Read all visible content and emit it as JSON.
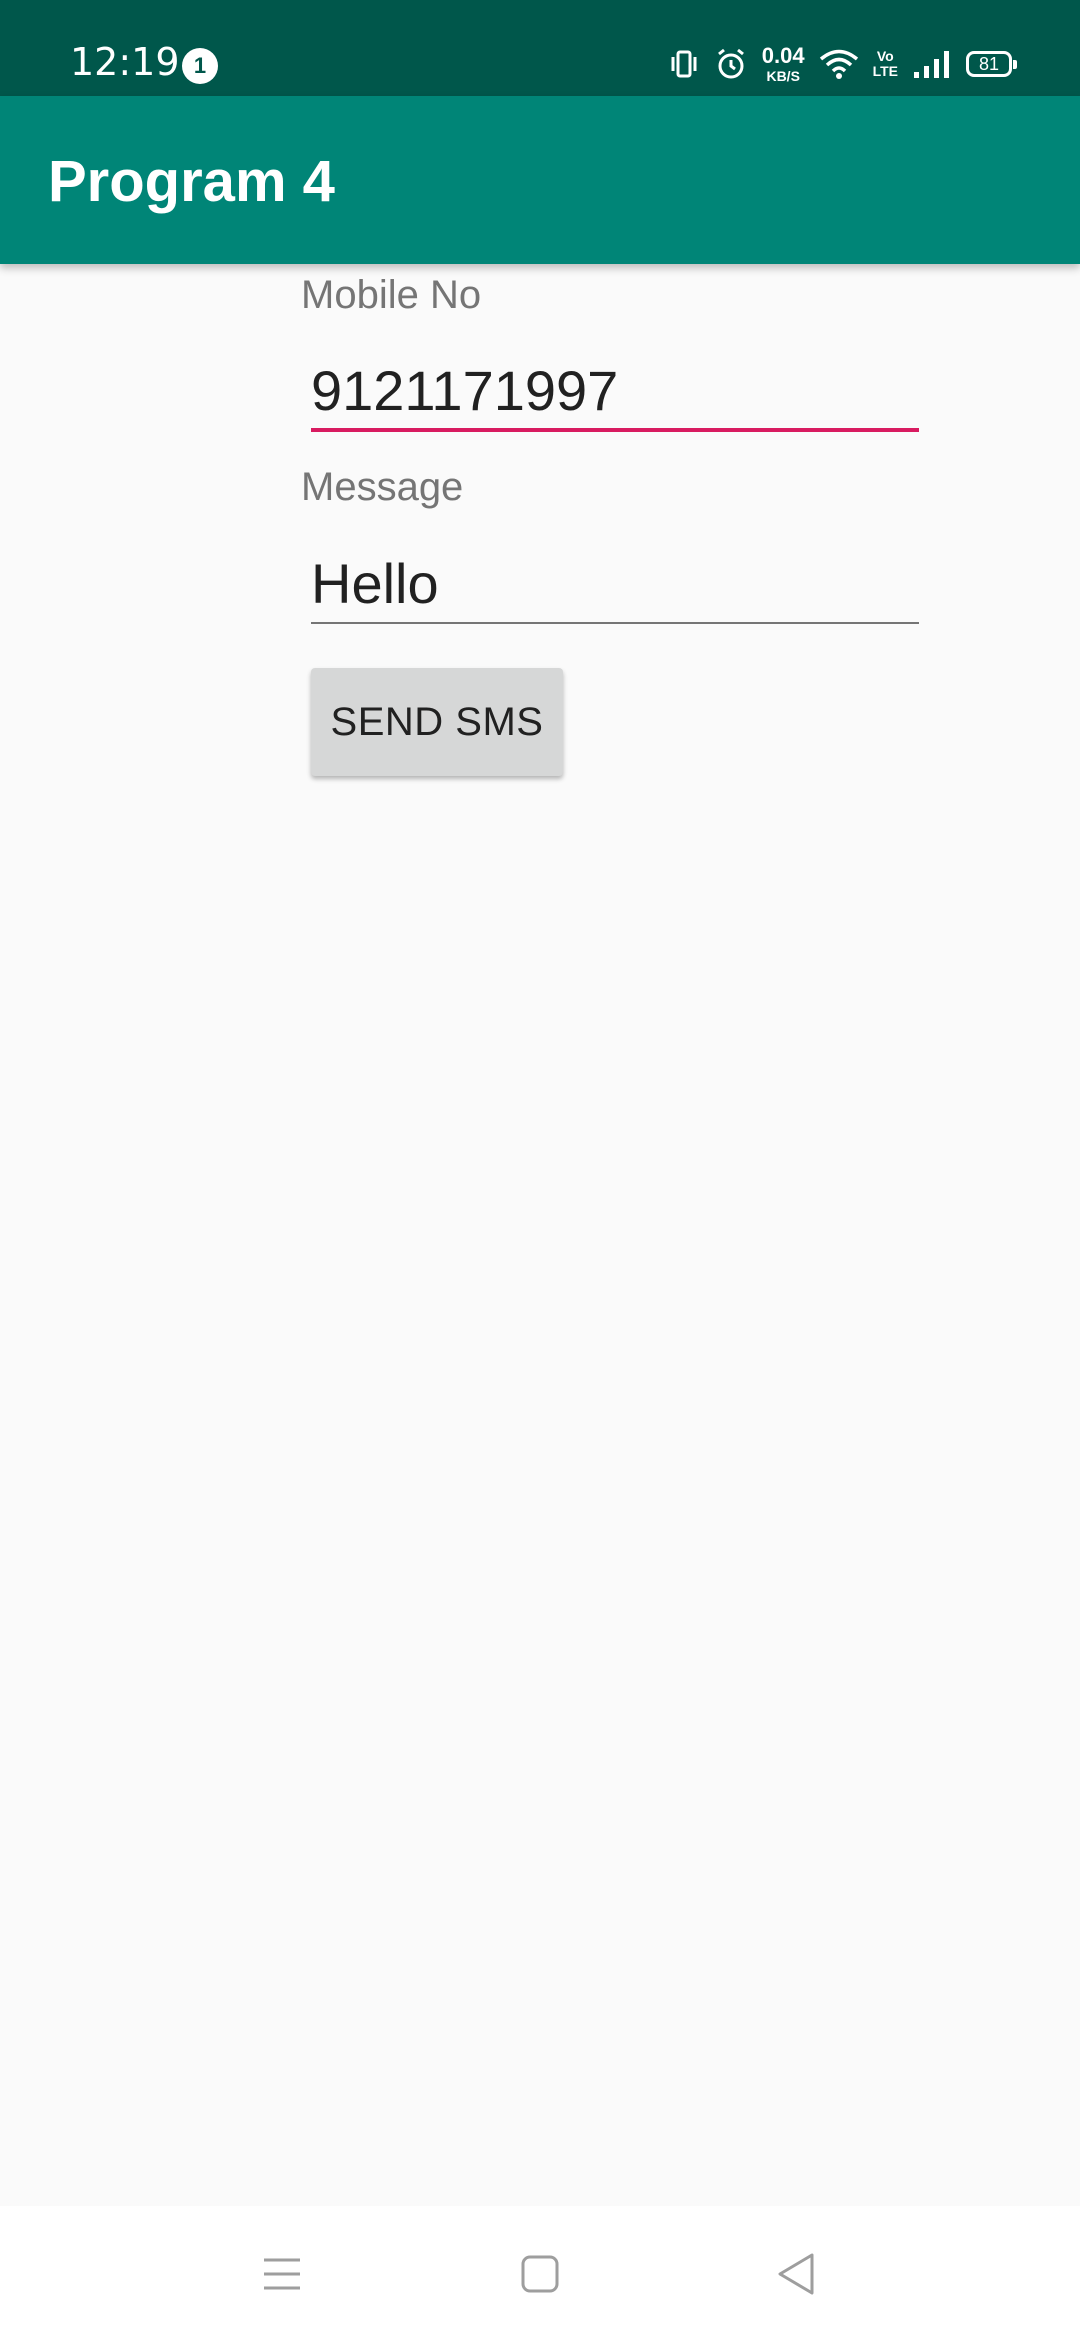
{
  "status_bar": {
    "time": "12:19",
    "notification_count": "1",
    "net_speed_value": "0.04",
    "net_speed_unit": "KB/S",
    "volte_top": "Vo",
    "volte_bottom": "LTE",
    "battery_level": "81",
    "icons": [
      "vibrate-icon",
      "alarm-icon",
      "wifi-icon",
      "volte-icon",
      "signal-icon",
      "battery-icon"
    ]
  },
  "app_bar": {
    "title": "Program 4"
  },
  "form": {
    "mobile_label": "Mobile No",
    "mobile_value": "9121171997",
    "message_label": "Message",
    "message_value": "Hello",
    "send_button_label": "SEND SMS"
  },
  "nav_bar": {
    "icons": [
      "menu-icon",
      "home-icon",
      "back-icon"
    ]
  },
  "colors": {
    "status_bar": "#00574b",
    "app_bar": "#008577",
    "accent": "#d81b60",
    "background": "#fafafa"
  }
}
